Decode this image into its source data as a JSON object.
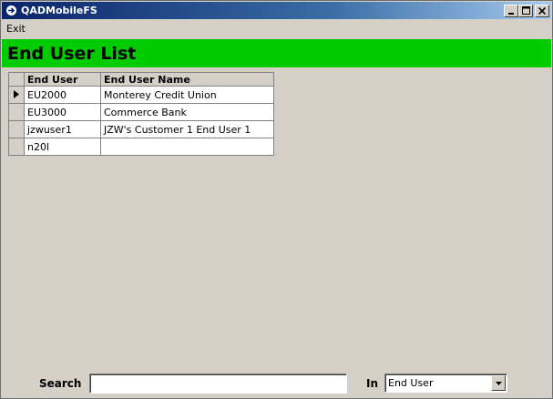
{
  "window": {
    "title": "QADMobileFS",
    "icon": "app-circle-arrow-icon",
    "controls": {
      "minimize": "_",
      "maximize": "□",
      "close": "×"
    }
  },
  "menubar": {
    "items": [
      {
        "label": "Exit"
      }
    ]
  },
  "page": {
    "heading": "End User List",
    "heading_bg": "#00cc00"
  },
  "table": {
    "columns": [
      "End User",
      "End User Name"
    ],
    "rows": [
      {
        "user": "EU2000",
        "name": "Monterey Credit Union",
        "selected": true
      },
      {
        "user": "EU3000",
        "name": "Commerce Bank",
        "selected": false
      },
      {
        "user": "jzwuser1",
        "name": "JZW's Customer 1 End User 1",
        "selected": false
      },
      {
        "user": "n20l",
        "name": "",
        "selected": false
      }
    ]
  },
  "search": {
    "label": "Search",
    "value": "",
    "in_label": "In",
    "field_selected": "End User"
  }
}
